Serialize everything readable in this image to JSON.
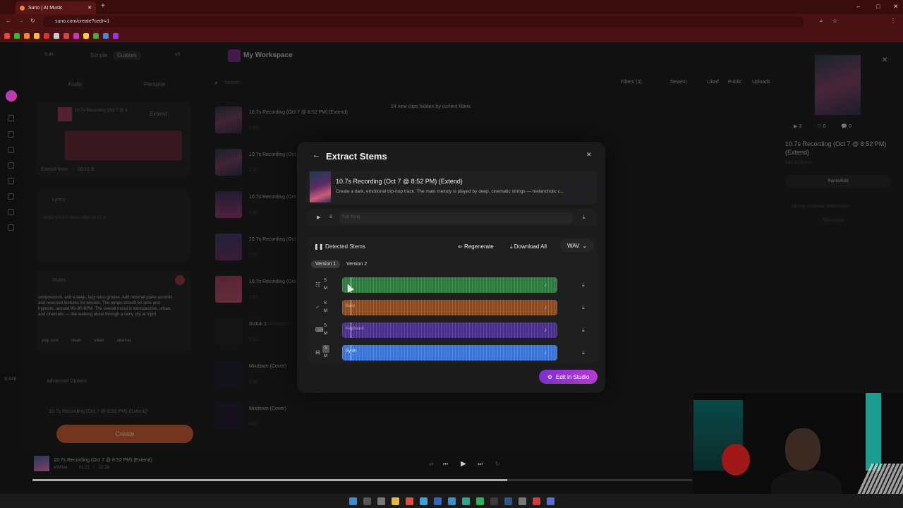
{
  "browser": {
    "tab_title": "Suno | AI Music",
    "url": "suno.com/create?cedr=1"
  },
  "left": {
    "credits": "9.4k",
    "mode_simple": "Simple",
    "mode_custom": "Custom",
    "version": "v5",
    "add_audio": "Audio",
    "add_persona": "Persona",
    "clip_title": "10.7s Recording (Oct 7 @ 8",
    "extend_label": "Extend",
    "extend_from_label": "Extend from",
    "extend_from_time": "00:01.9",
    "lyrics_label": "Lyrics",
    "lyrics_placeholder": "Write lyrics to insert after 00:01.9",
    "styles_label": "Styles",
    "styles_text": "compression, and a deep, lazy bass groove. Add minimal piano accents and reversed textures for tension. The tempo should be slow and hypnotic, around 80–90 BPM. The overall mood is introspective, urban, and cinematic — like walking alone through a rainy city at night.",
    "style_tags": [
      "pop rock",
      "clean",
      "vibes",
      "alternat"
    ],
    "advanced_label": "Advanced Options",
    "song_title_field": "10.7s Recording (Oct 7 @ 8:52 PM) (Extend)",
    "create_label": "Create",
    "side_counter": "9,448"
  },
  "workspace": {
    "title": "My Workspace",
    "search_placeholder": "Search",
    "filters_label": "Filters (3)",
    "sort_label": "Newest",
    "liked": "Liked",
    "public": "Public",
    "uploads": "Uploads",
    "hidden_notice": "24 new clips hidden by current filters",
    "rows": [
      {
        "title": "10.7s Recording (Oct 7 @ 8:52 PM) (Extend)",
        "duration": "3:05"
      },
      {
        "title": "10.7s Recording (Oct",
        "duration": "3:20"
      },
      {
        "title": "10.7s Recording (Oct",
        "duration": "2:43"
      },
      {
        "title": "10.7s Recording (Oct",
        "duration": "3:03"
      },
      {
        "title": "10.7s Recording (Oct",
        "duration": "3:10"
      },
      {
        "title": "duduk 1",
        "duration": "0:11"
      },
      {
        "title": "Mixdown (Cover)",
        "duration": "3:58"
      },
      {
        "title": "Mixdown (Cover)",
        "duration": "4:01"
      }
    ],
    "duduk_tag": "Uploaded"
  },
  "right": {
    "plays": "3",
    "likes": "0",
    "comments": "0",
    "title": "10.7s Recording (Oct 7 @ 8:52 PM) (Extend)",
    "caption": "Add a Caption",
    "remix": "Remix/Edit",
    "tags": "trip-hop cinematic downtempo",
    "show_more": "Show More"
  },
  "modal": {
    "title": "Extract Stems",
    "song_title": "10.7s Recording (Oct 7 @ 8:52 PM) (Extend)",
    "song_desc": "Create a dark, emotional trip-hop track. The main melody is played by deep, cinematic strings — melancholic c...",
    "full_song_label": "Full Song",
    "detected_label": "Detected Stems",
    "regenerate": "Regenerate",
    "download_all": "Download All",
    "format": "WAV",
    "version1": "Version 1",
    "version2": "Version 2",
    "solo": "S",
    "mute": "M",
    "stems": [
      {
        "name": "",
        "color": "#2f7a3f"
      },
      {
        "name": "Bass",
        "color": "#8a4a22"
      },
      {
        "name": "Keyboard",
        "color": "#4a2f8a"
      },
      {
        "name": "Synth",
        "color": "#3b74d4"
      }
    ],
    "edit_in_studio": "Edit in Studio"
  },
  "player": {
    "title": "10.7s Recording (Oct 7 @ 8:52 PM) (Extend)",
    "artist": "wWhite",
    "time": "01:21",
    "total": "02:28",
    "progress": 0.72
  }
}
